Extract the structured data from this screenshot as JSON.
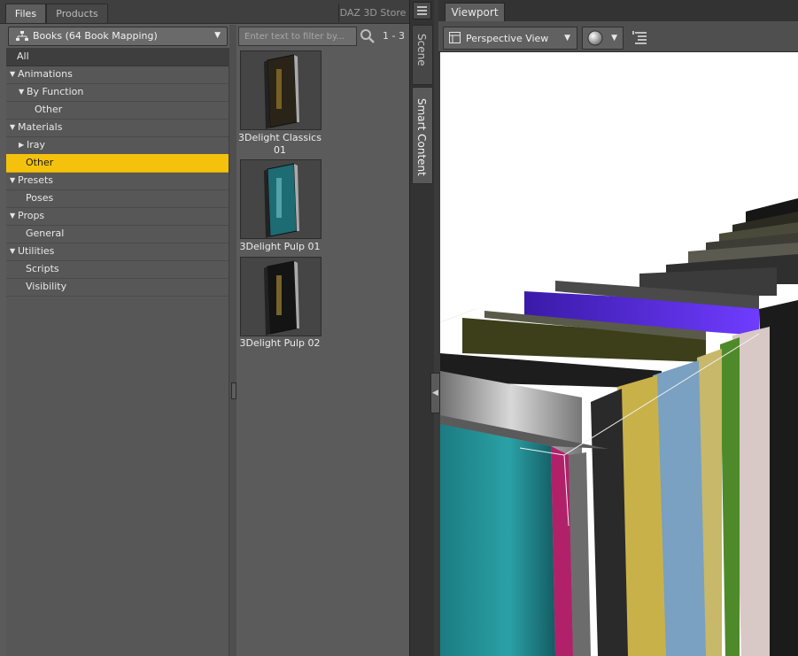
{
  "tabs": {
    "files": "Files",
    "products": "Products",
    "store": "DAZ 3D Store"
  },
  "category_dropdown": {
    "value": "Books (64 Book Mapping)"
  },
  "tree": [
    {
      "label": "All",
      "level": 0,
      "expander": "none",
      "selected": false
    },
    {
      "label": "Animations",
      "level": 0,
      "expander": "expanded",
      "selected": false
    },
    {
      "label": "By Function",
      "level": 1,
      "expander": "expanded",
      "selected": false
    },
    {
      "label": "Other",
      "level": 2,
      "expander": "none",
      "selected": false
    },
    {
      "label": "Materials",
      "level": 0,
      "expander": "expanded",
      "selected": false
    },
    {
      "label": "Iray",
      "level": 1,
      "expander": "collapsed",
      "selected": false
    },
    {
      "label": "Other",
      "level": 1,
      "expander": "none",
      "selected": true
    },
    {
      "label": "Presets",
      "level": 0,
      "expander": "expanded",
      "selected": false
    },
    {
      "label": "Poses",
      "level": 1,
      "expander": "none",
      "selected": false
    },
    {
      "label": "Props",
      "level": 0,
      "expander": "expanded",
      "selected": false
    },
    {
      "label": "General",
      "level": 1,
      "expander": "none",
      "selected": false
    },
    {
      "label": "Utilities",
      "level": 0,
      "expander": "expanded",
      "selected": false
    },
    {
      "label": "Scripts",
      "level": 1,
      "expander": "none",
      "selected": false
    },
    {
      "label": "Visibility",
      "level": 1,
      "expander": "none",
      "selected": false
    }
  ],
  "filter": {
    "placeholder": "Enter text to filter by...",
    "value": ""
  },
  "result_count": "1 - 3",
  "content_items": [
    {
      "caption_line1": "3Delight Classics",
      "caption_line2": "01",
      "cover_color": "#2a2418",
      "accent": "#b8902d"
    },
    {
      "caption_line1": "3Delight Pulp 01",
      "caption_line2": "",
      "cover_color": "#1d6b73",
      "accent": "#7fd0d6"
    },
    {
      "caption_line1": "3Delight Pulp 02",
      "caption_line2": "",
      "cover_color": "#141414",
      "accent": "#c9a23a"
    }
  ],
  "side_tabs": {
    "scene": "Scene",
    "smart_content": "Smart Content"
  },
  "viewport": {
    "tab_label": "Viewport",
    "view_mode": "Perspective View"
  },
  "colors": {
    "selection": "#f4c20d",
    "panel": "#5b5b5b",
    "viewport_bg": "#ffffff"
  }
}
